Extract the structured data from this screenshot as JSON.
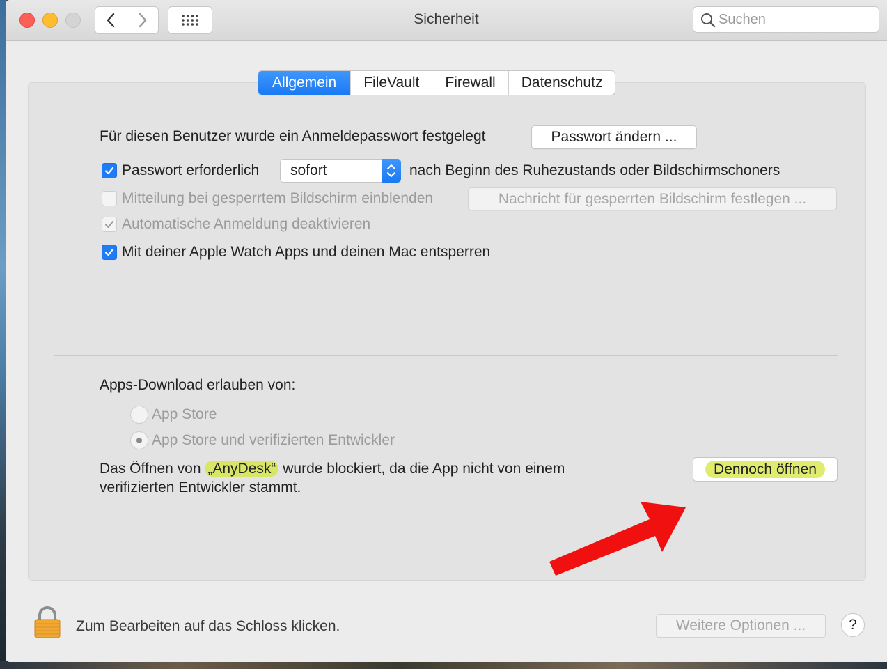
{
  "window": {
    "title": "Sicherheit",
    "search_placeholder": "Suchen"
  },
  "tabs": [
    {
      "label": "Allgemein",
      "active": true
    },
    {
      "label": "FileVault",
      "active": false
    },
    {
      "label": "Firewall",
      "active": false
    },
    {
      "label": "Datenschutz",
      "active": false
    }
  ],
  "general": {
    "password_set_text": "Für diesen Benutzer wurde ein Anmeldepasswort festgelegt",
    "change_password_button": "Passwort ändern ...",
    "require_password": {
      "label": "Passwort erforderlich",
      "checked": true
    },
    "require_password_delay": "sofort",
    "require_password_suffix": "nach Beginn des Ruhezustands oder Bildschirmschoners",
    "show_message": {
      "label": "Mitteilung bei gesperrtem Bildschirm einblenden",
      "checked": false,
      "enabled": false
    },
    "set_message_button": "Nachricht für gesperrten Bildschirm festlegen ...",
    "disable_auto_login": {
      "label": "Automatische Anmeldung deaktivieren",
      "checked": true,
      "enabled": false
    },
    "apple_watch_unlock": {
      "label": "Mit deiner Apple Watch Apps und deinen Mac entsperren",
      "checked": true
    }
  },
  "downloads": {
    "heading": "Apps-Download erlauben von:",
    "options": [
      {
        "label": "App Store",
        "selected": false
      },
      {
        "label": "App Store und verifizierten Entwickler",
        "selected": true
      }
    ],
    "blocked_prefix": "Das Öffnen von ",
    "blocked_app": "„AnyDesk“",
    "blocked_suffix": " wurde blockiert, da die App nicht von einem",
    "blocked_line2": "verifizierten Entwickler stammt.",
    "open_anyway_button": "Dennoch öffnen"
  },
  "footer": {
    "lock_text": "Zum Bearbeiten auf das Schloss klicken.",
    "advanced_button": "Weitere Optionen ...",
    "help_label": "?"
  },
  "colors": {
    "accent": "#1f7cf5",
    "highlight": "#d6e63c",
    "annotation_arrow": "#f01010"
  }
}
